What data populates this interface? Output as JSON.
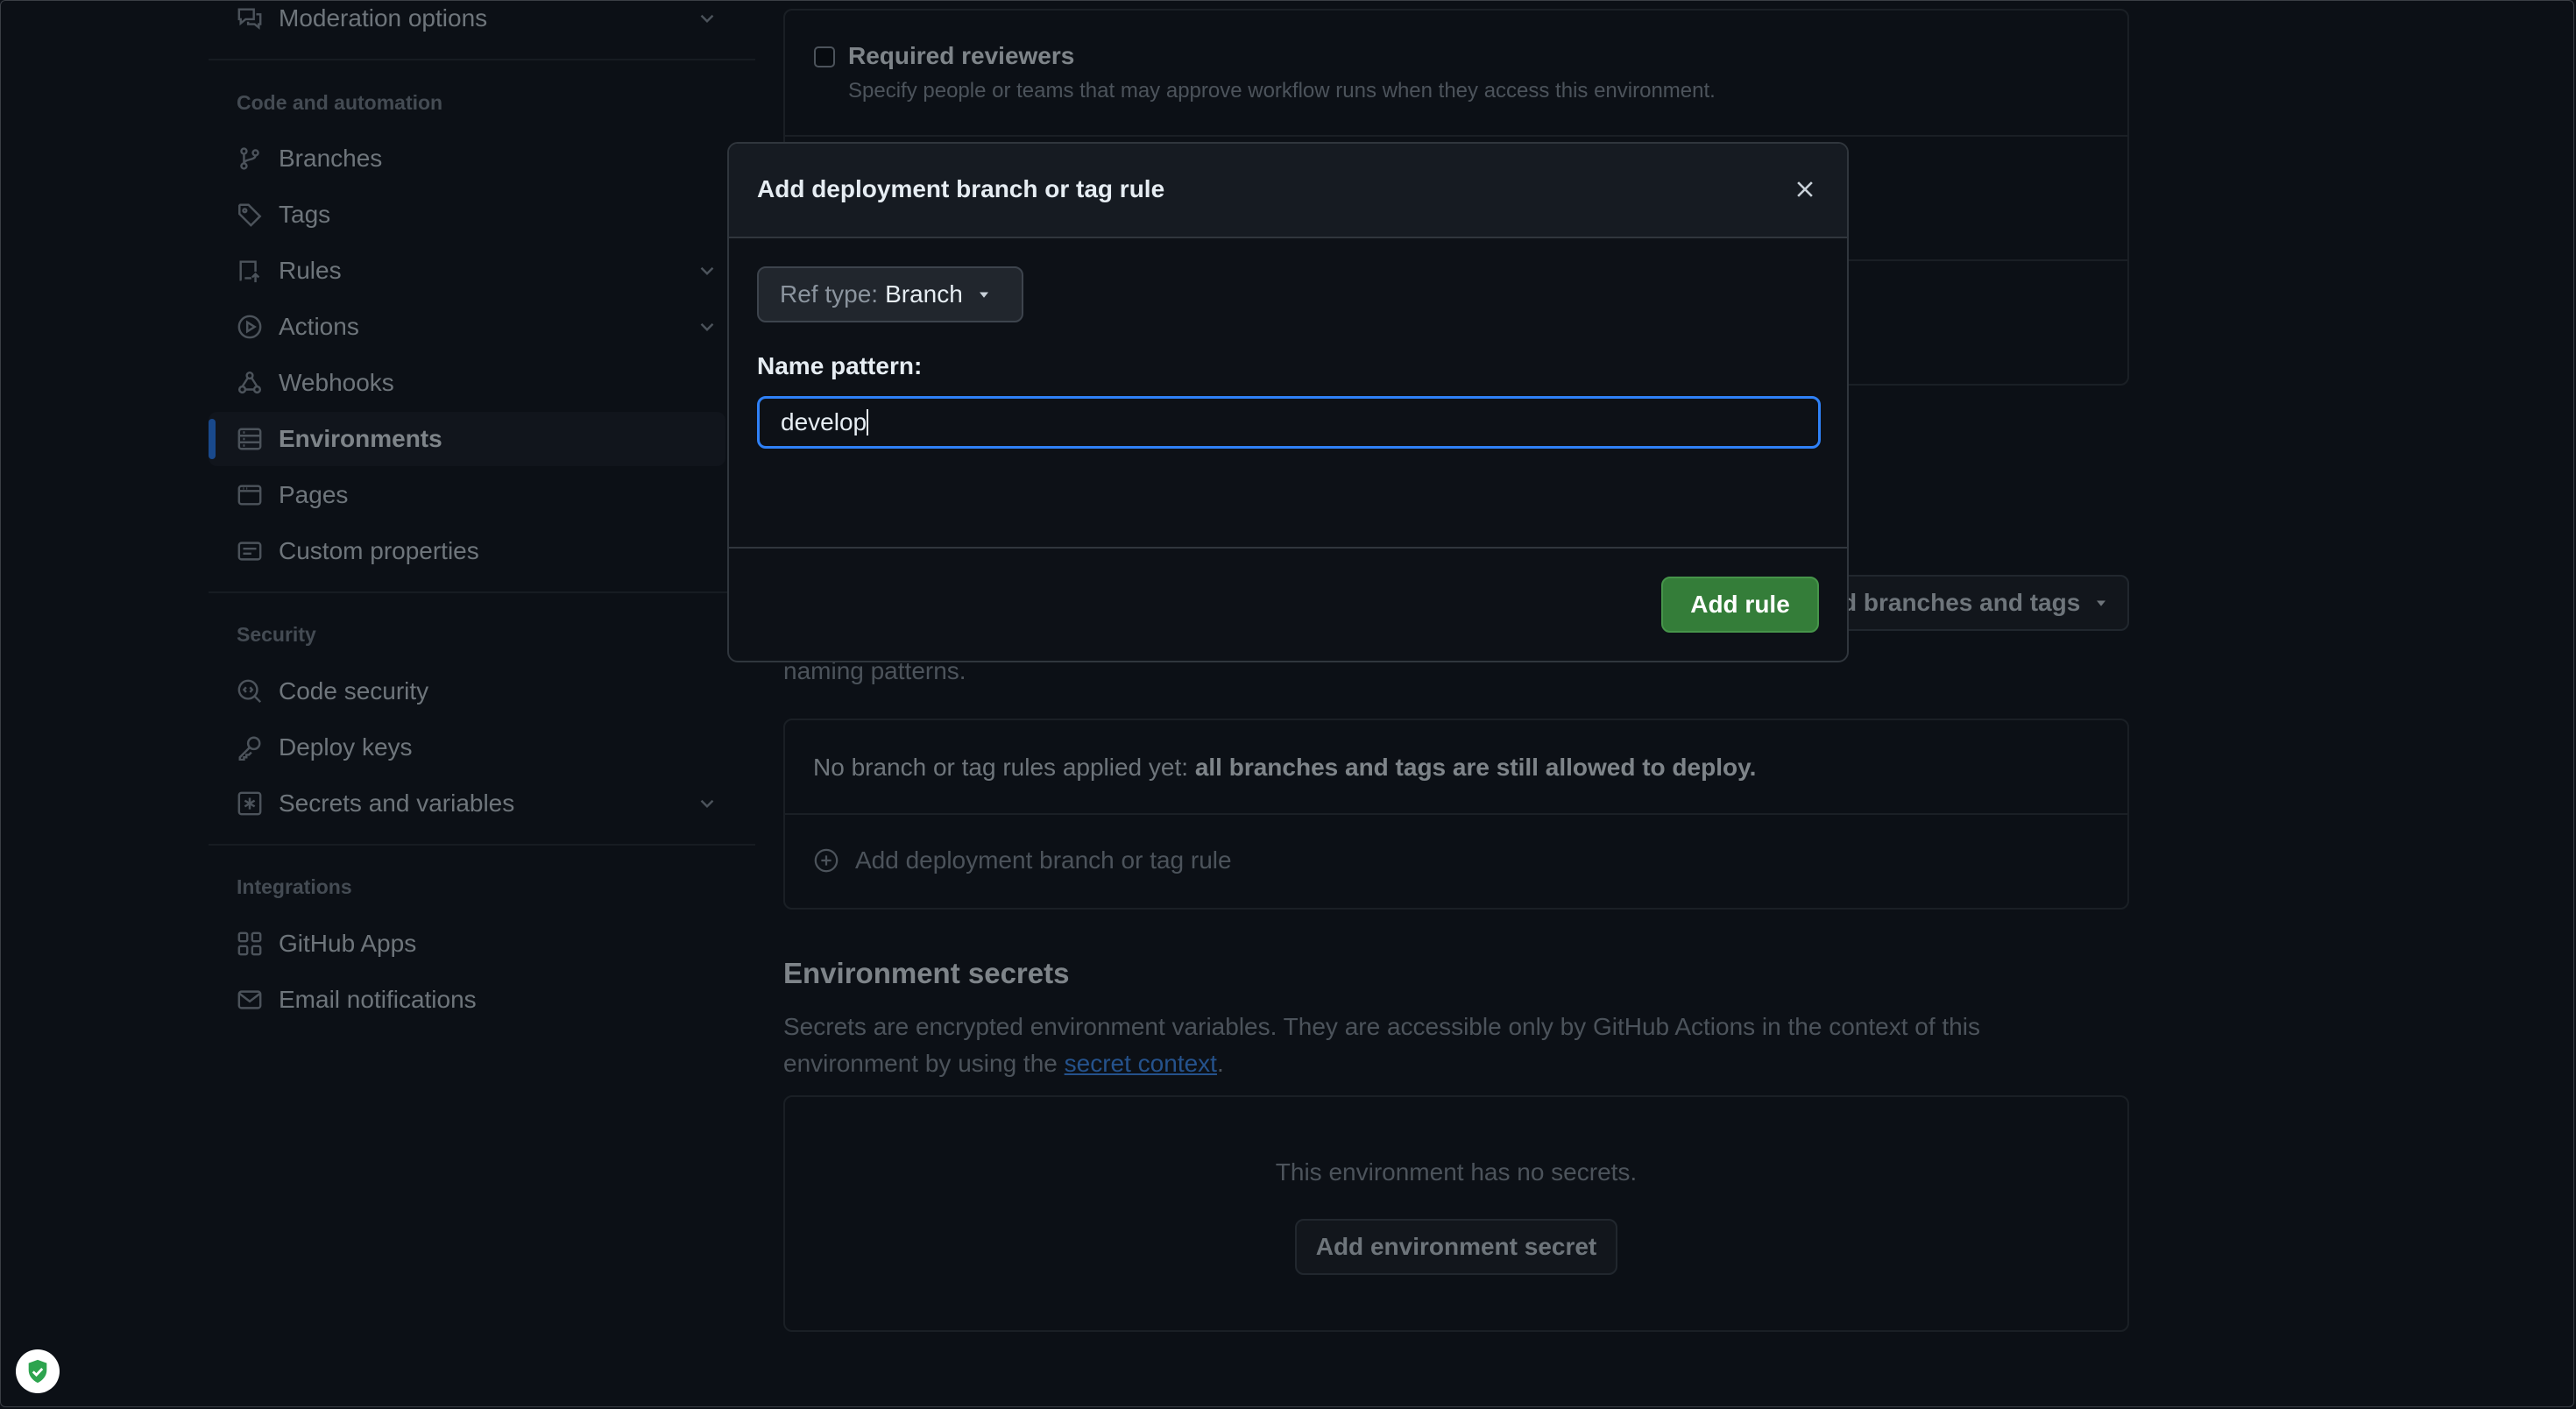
{
  "sidebar": {
    "moderation_options": "Moderation options",
    "code_automation_heading": "Code and automation",
    "items": [
      {
        "label": "Branches"
      },
      {
        "label": "Tags"
      },
      {
        "label": "Rules"
      },
      {
        "label": "Actions"
      },
      {
        "label": "Webhooks"
      },
      {
        "label": "Environments"
      },
      {
        "label": "Pages"
      },
      {
        "label": "Custom properties"
      }
    ],
    "security_heading": "Security",
    "security_items": [
      {
        "label": "Code security"
      },
      {
        "label": "Deploy keys"
      },
      {
        "label": "Secrets and variables"
      }
    ],
    "integrations_heading": "Integrations",
    "integration_items": [
      {
        "label": "GitHub Apps"
      },
      {
        "label": "Email notifications"
      }
    ]
  },
  "main": {
    "required_reviewers": {
      "title": "Required reviewers",
      "description": "Specify people or teams that may approve workflow runs when they access this environment."
    },
    "deployment_dropdown_label": "d branches and tags",
    "naming_patterns_text": "naming patterns.",
    "no_rules_prefix": "No branch or tag rules applied yet: ",
    "no_rules_bold": "all branches and tags are still allowed to deploy.",
    "add_rule_link": "Add deployment branch or tag rule",
    "secrets": {
      "title": "Environment secrets",
      "description_line1": "Secrets are encrypted environment variables. They are accessible only by GitHub Actions in the context of this",
      "description_line2_prefix": "environment by using the ",
      "description_link": "secret context",
      "description_suffix": ".",
      "empty_text": "This environment has no secrets.",
      "add_button": "Add environment secret"
    }
  },
  "dialog": {
    "title": "Add deployment branch or tag rule",
    "ref_type_prefix": "Ref type: ",
    "ref_type_value": "Branch",
    "name_pattern_label": "Name pattern:",
    "name_pattern_value": "develop",
    "add_rule_button": "Add rule"
  },
  "colors": {
    "accent": "#2f81f7",
    "success": "#347d39",
    "link": "#4493f8"
  }
}
